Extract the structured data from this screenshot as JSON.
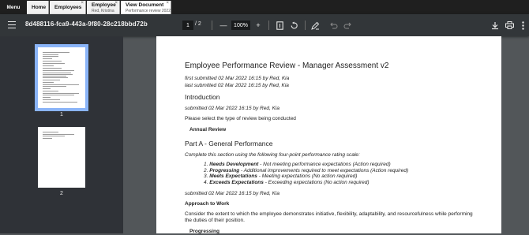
{
  "appbar": {
    "menu_label": "Menu",
    "tabs": [
      {
        "title": "Home"
      },
      {
        "title": "Employees",
        "close": "×"
      },
      {
        "title": "Employee",
        "subtitle": "Red, Kristina",
        "close": "×"
      },
      {
        "title": "View Document",
        "subtitle": "Performance review 2022",
        "close": "×"
      }
    ]
  },
  "toolbar": {
    "doc_title": "8d488116-fca9-443a-9f80-28c218bbd72b",
    "current_page": "1",
    "page_separator": "/",
    "total_pages": "2",
    "zoom_out": "—",
    "zoom": "100%",
    "zoom_in": "+",
    "icons": [
      "fit-page-icon",
      "rotate-icon",
      "annotate-icon",
      "undo-icon",
      "redo-icon",
      "download-icon",
      "print-icon",
      "more-icon"
    ]
  },
  "sidebar": {
    "thumbnails": [
      {
        "label": "1"
      },
      {
        "label": "2"
      }
    ]
  },
  "document": {
    "title": "Employee Performance Review - Manager Assessment v2",
    "first_submitted": "first submitted 02 Mar 2022 16:15 by Red, Kia",
    "last_submitted": "last submitted 02 Mar 2022 16:15 by Red, Kia",
    "intro_heading": "Introduction",
    "intro_submitted": "submitted 02 Mar 2022 16:15 by Red, Kia",
    "intro_prompt": "Please select the type of review being conducted",
    "review_type": "Annual Review",
    "part_a_heading": "Part A - General Performance",
    "part_a_instructions": "Complete this section using the following four-point performance rating scale:",
    "ratings": [
      {
        "num": "1.",
        "term": "Needs Development",
        "desc": " - Not meeting performance expectations (Action required)"
      },
      {
        "num": "2.",
        "term": "Progressing",
        "desc": " - Additional improvements required to meet expectations (Action required)"
      },
      {
        "num": "3.",
        "term": "Meets Expectations",
        "desc": " - Meeting expectations (No action required)"
      },
      {
        "num": "4.",
        "term": "Exceeds Expectations",
        "desc": " - Exceeding expectations (No action required)"
      }
    ],
    "part_a_submitted": "submitted 02 Mar 2022 16:15 by Red, Kia",
    "approach_heading": "Approach to Work",
    "approach_text": "Consider the extent to which the employee demonstrates initiative, flexibility, adaptability, and resourcefulness while performing the duties of their position.",
    "approach_rating": "Progressing"
  }
}
